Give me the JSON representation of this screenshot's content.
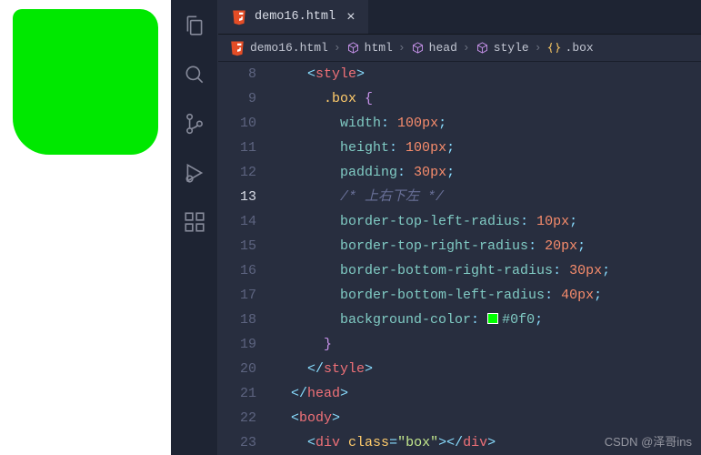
{
  "tab": {
    "filename": "demo16.html",
    "close": "×"
  },
  "breadcrumb": {
    "file": "demo16.html",
    "html": "html",
    "head": "head",
    "style": "style",
    "box": ".box"
  },
  "lines": {
    "l8": {
      "num": "8",
      "indent": "    ",
      "open": "<",
      "tag": "style",
      "close": ">"
    },
    "l9": {
      "num": "9",
      "indent": "      ",
      "sel": ".box ",
      "brace": "{"
    },
    "l10": {
      "num": "10",
      "indent": "        ",
      "prop": "width",
      "val": "100",
      "unit": "px"
    },
    "l11": {
      "num": "11",
      "indent": "        ",
      "prop": "height",
      "val": "100",
      "unit": "px"
    },
    "l12": {
      "num": "12",
      "indent": "        ",
      "prop": "padding",
      "val": "30",
      "unit": "px"
    },
    "l13": {
      "num": "13",
      "indent": "        ",
      "comment": "/* 上右下左 */"
    },
    "l14": {
      "num": "14",
      "indent": "        ",
      "prop": "border-top-left-radius",
      "val": "10",
      "unit": "px"
    },
    "l15": {
      "num": "15",
      "indent": "        ",
      "prop": "border-top-right-radius",
      "val": "20",
      "unit": "px"
    },
    "l16": {
      "num": "16",
      "indent": "        ",
      "prop": "border-bottom-right-radius",
      "val": "30",
      "unit": "px"
    },
    "l17": {
      "num": "17",
      "indent": "        ",
      "prop": "border-bottom-left-radius",
      "val": "40",
      "unit": "px"
    },
    "l18": {
      "num": "18",
      "indent": "        ",
      "prop": "background-color",
      "hex": "#0f0"
    },
    "l19": {
      "num": "19",
      "indent": "      ",
      "brace": "}"
    },
    "l20": {
      "num": "20",
      "indent": "    ",
      "open": "</",
      "tag": "style",
      "close": ">"
    },
    "l21": {
      "num": "21",
      "indent": "  ",
      "open": "</",
      "tag": "head",
      "close": ">"
    },
    "l22": {
      "num": "22",
      "indent": "  ",
      "open": "<",
      "tag": "body",
      "close": ">"
    },
    "l23": {
      "num": "23",
      "indent": "    ",
      "open": "<",
      "tag": "div",
      "attr": " class",
      "eq": "=",
      "str": "\"box\"",
      "close": ">",
      "open2": "</",
      "tag2": "div",
      "close2": ">"
    }
  },
  "watermark": "CSDN @泽哥ins"
}
